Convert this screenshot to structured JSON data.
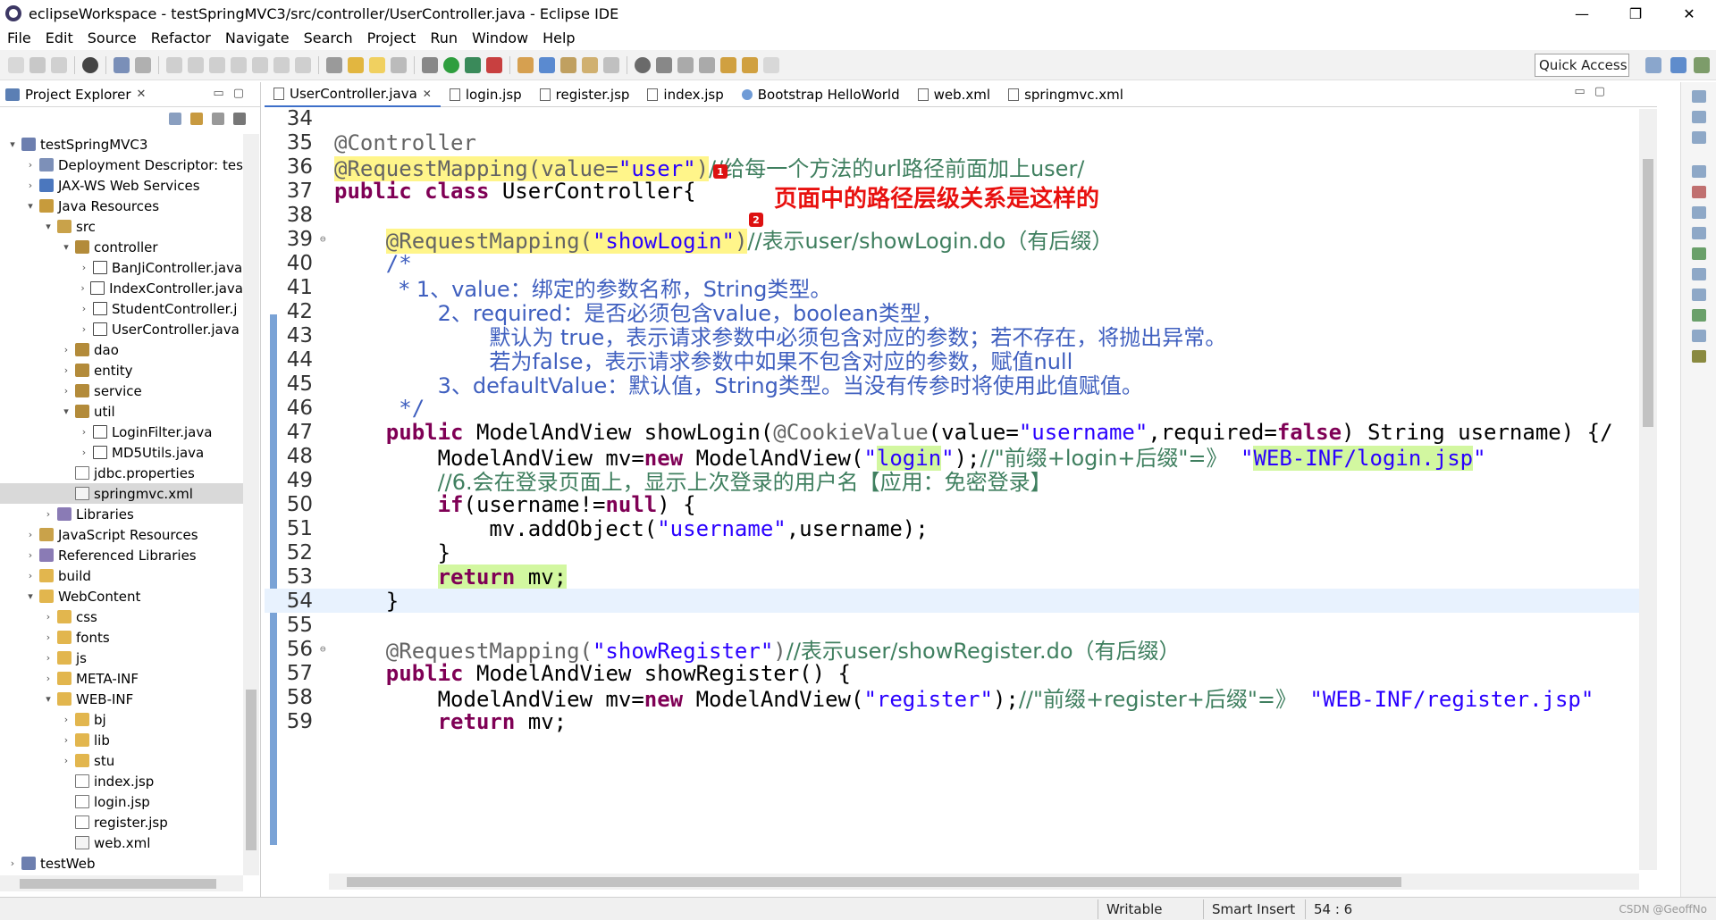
{
  "window": {
    "title": "eclipseWorkspace - testSpringMVC3/src/controller/UserController.java - Eclipse IDE",
    "controls": [
      "—",
      "❐",
      "✕"
    ]
  },
  "menu": [
    "File",
    "Edit",
    "Source",
    "Refactor",
    "Navigate",
    "Search",
    "Project",
    "Run",
    "Window",
    "Help"
  ],
  "toolbar": {
    "quick_access": "Quick Access"
  },
  "project_explorer": {
    "title": "Project Explorer",
    "close": "✕",
    "tree": [
      {
        "label": "testSpringMVC3",
        "twisty": "▾",
        "icon": "ic-project",
        "icon_name": "project-icon"
      },
      {
        "label": "Deployment Descriptor: tes",
        "twisty": "›",
        "icon": "ic-descriptor",
        "icon_name": "deployment-descriptor-icon"
      },
      {
        "label": "JAX-WS Web Services",
        "twisty": "›",
        "icon": "ic-ws",
        "icon_name": "web-services-icon"
      },
      {
        "label": "Java Resources",
        "twisty": "▾",
        "icon": "ic-javares",
        "icon_name": "java-resources-icon"
      },
      {
        "label": "src",
        "twisty": "▾",
        "icon": "ic-srcfolder",
        "icon_name": "source-folder-icon"
      },
      {
        "label": "controller",
        "twisty": "▾",
        "icon": "ic-package",
        "icon_name": "package-icon"
      },
      {
        "label": "BanJiController.java",
        "twisty": "›",
        "icon": "ic-java",
        "icon_name": "java-file-icon"
      },
      {
        "label": "IndexController.java",
        "twisty": "›",
        "icon": "ic-java",
        "icon_name": "java-file-icon"
      },
      {
        "label": "StudentController.j",
        "twisty": "›",
        "icon": "ic-java",
        "icon_name": "java-file-icon"
      },
      {
        "label": "UserController.java",
        "twisty": "›",
        "icon": "ic-java",
        "icon_name": "java-file-icon"
      },
      {
        "label": "dao",
        "twisty": "›",
        "icon": "ic-package",
        "icon_name": "package-icon"
      },
      {
        "label": "entity",
        "twisty": "›",
        "icon": "ic-package",
        "icon_name": "package-icon"
      },
      {
        "label": "service",
        "twisty": "›",
        "icon": "ic-package",
        "icon_name": "package-icon"
      },
      {
        "label": "util",
        "twisty": "▾",
        "icon": "ic-package",
        "icon_name": "package-icon"
      },
      {
        "label": "LoginFilter.java",
        "twisty": "›",
        "icon": "ic-java",
        "icon_name": "java-file-icon"
      },
      {
        "label": "MD5Utils.java",
        "twisty": "›",
        "icon": "ic-java",
        "icon_name": "java-file-icon"
      },
      {
        "label": "jdbc.properties",
        "twisty": "",
        "icon": "ic-file",
        "icon_name": "properties-file-icon"
      },
      {
        "label": "springmvc.xml",
        "twisty": "",
        "icon": "ic-xml",
        "icon_name": "xml-file-icon",
        "selected": true
      },
      {
        "label": "Libraries",
        "twisty": "›",
        "icon": "ic-lib",
        "icon_name": "libraries-icon"
      },
      {
        "label": "JavaScript Resources",
        "twisty": "›",
        "icon": "ic-js",
        "icon_name": "javascript-resources-icon"
      },
      {
        "label": "Referenced Libraries",
        "twisty": "›",
        "icon": "ic-lib",
        "icon_name": "referenced-libraries-icon"
      },
      {
        "label": "build",
        "twisty": "›",
        "icon": "ic-folder",
        "icon_name": "folder-icon"
      },
      {
        "label": "WebContent",
        "twisty": "▾",
        "icon": "ic-folder",
        "icon_name": "folder-icon"
      },
      {
        "label": "css",
        "twisty": "›",
        "icon": "ic-folder",
        "icon_name": "folder-icon"
      },
      {
        "label": "fonts",
        "twisty": "›",
        "icon": "ic-folder",
        "icon_name": "folder-icon"
      },
      {
        "label": "js",
        "twisty": "›",
        "icon": "ic-folder",
        "icon_name": "folder-icon"
      },
      {
        "label": "META-INF",
        "twisty": "›",
        "icon": "ic-folder",
        "icon_name": "folder-icon"
      },
      {
        "label": "WEB-INF",
        "twisty": "▾",
        "icon": "ic-folder",
        "icon_name": "folder-icon"
      },
      {
        "label": "bj",
        "twisty": "›",
        "icon": "ic-folder",
        "icon_name": "folder-icon"
      },
      {
        "label": "lib",
        "twisty": "›",
        "icon": "ic-folder",
        "icon_name": "folder-icon"
      },
      {
        "label": "stu",
        "twisty": "›",
        "icon": "ic-folder",
        "icon_name": "folder-icon"
      },
      {
        "label": "index.jsp",
        "twisty": "",
        "icon": "ic-file",
        "icon_name": "jsp-file-icon"
      },
      {
        "label": "login.jsp",
        "twisty": "",
        "icon": "ic-file",
        "icon_name": "jsp-file-icon"
      },
      {
        "label": "register.jsp",
        "twisty": "",
        "icon": "ic-file",
        "icon_name": "jsp-file-icon"
      },
      {
        "label": "web.xml",
        "twisty": "",
        "icon": "ic-xml",
        "icon_name": "xml-file-icon"
      },
      {
        "label": "testWeb",
        "twisty": "›",
        "icon": "ic-project",
        "icon_name": "project-icon"
      }
    ]
  },
  "editor": {
    "tabs": [
      {
        "label": "UserController.java",
        "kind": "java",
        "active": true,
        "close": "✕"
      },
      {
        "label": "login.jsp",
        "kind": "file"
      },
      {
        "label": "register.jsp",
        "kind": "file"
      },
      {
        "label": "index.jsp",
        "kind": "file"
      },
      {
        "label": "Bootstrap HelloWorld",
        "kind": "globe"
      },
      {
        "label": "web.xml",
        "kind": "file"
      },
      {
        "label": "springmvc.xml",
        "kind": "file"
      }
    ],
    "markers": [
      "1",
      "2"
    ],
    "annotation_note": "页面中的路径层级关系是这样的",
    "lines": [
      {
        "n": "34",
        "segs": []
      },
      {
        "n": "35",
        "segs": [
          [
            "ann",
            "@Controller"
          ]
        ]
      },
      {
        "n": "36",
        "segs": [
          [
            "ann hl-yellow",
            "@RequestMapping(value="
          ],
          [
            "str hl-yellow",
            "\"user\""
          ],
          [
            "ann hl-yellow",
            ")"
          ],
          [
            "lcmt cjk",
            "//给每一个方法的url路径前面加上user/"
          ]
        ]
      },
      {
        "n": "37",
        "segs": [
          [
            "kw",
            "public"
          ],
          [
            "",
            " "
          ],
          [
            "kw",
            "class"
          ],
          [
            "",
            " UserController{"
          ]
        ]
      },
      {
        "n": "38",
        "segs": []
      },
      {
        "n": "39",
        "fold": "⊖",
        "segs": [
          [
            "",
            "    "
          ],
          [
            "ann hl-yellow",
            "@RequestMapping("
          ],
          [
            "str hl-yellow",
            "\"showLogin\""
          ],
          [
            "ann hl-yellow",
            ")"
          ],
          [
            "lcmt cjk",
            "//表示user/showLogin.do（有后缀）"
          ]
        ]
      },
      {
        "n": "40",
        "segs": [
          [
            "",
            "    "
          ],
          [
            "cmt",
            "/*"
          ]
        ]
      },
      {
        "n": "41",
        "segs": [
          [
            "",
            "     "
          ],
          [
            "cmt cjk",
            "* 1、value：绑定的参数名称，String类型。"
          ]
        ]
      },
      {
        "n": "42",
        "segs": [
          [
            "",
            "        "
          ],
          [
            "cmt cjk",
            "2、required：是否必须包含value，boolean类型，"
          ]
        ]
      },
      {
        "n": "43",
        "segs": [
          [
            "",
            "            "
          ],
          [
            "cmt cjk",
            "默认为 true，表示请求参数中必须包含对应的参数；若不存在，将抛出异常。"
          ]
        ]
      },
      {
        "n": "44",
        "segs": [
          [
            "",
            "            "
          ],
          [
            "cmt cjk",
            "若为false，表示请求参数中如果不包含对应的参数，赋值null"
          ]
        ]
      },
      {
        "n": "45",
        "segs": [
          [
            "",
            "        "
          ],
          [
            "cmt cjk",
            "3、defaultValue：默认值，String类型。当没有传参时将使用此值赋值。"
          ]
        ]
      },
      {
        "n": "46",
        "segs": [
          [
            "",
            "     "
          ],
          [
            "cmt",
            "*/"
          ]
        ]
      },
      {
        "n": "47",
        "segs": [
          [
            "",
            "    "
          ],
          [
            "kw",
            "public"
          ],
          [
            "",
            " ModelAndView showLogin("
          ],
          [
            "ann",
            "@CookieValue"
          ],
          [
            "",
            "(value="
          ],
          [
            "str",
            "\"username\""
          ],
          [
            "",
            ",required="
          ],
          [
            "kw",
            "false"
          ],
          [
            "",
            ") String username) {/"
          ]
        ]
      },
      {
        "n": "48",
        "segs": [
          [
            "",
            "        ModelAndView mv="
          ],
          [
            "kw",
            "new"
          ],
          [
            "",
            " ModelAndView("
          ],
          [
            "str",
            "\""
          ],
          [
            "str hl-green",
            "login"
          ],
          [
            "str",
            "\""
          ],
          [
            "",
            ");"
          ],
          [
            "lcmt cjk",
            "//\"前缀+login+后缀\"=》"
          ],
          [
            "str",
            " \""
          ],
          [
            "str hl-green",
            "WEB-INF/login.jsp"
          ],
          [
            "str",
            "\""
          ]
        ]
      },
      {
        "n": "49",
        "segs": [
          [
            "",
            "        "
          ],
          [
            "lcmt cjk",
            "//6.会在登录页面上，显示上次登录的用户名【应用：免密登录】"
          ]
        ]
      },
      {
        "n": "50",
        "segs": [
          [
            "",
            "        "
          ],
          [
            "kw",
            "if"
          ],
          [
            "",
            "(username!="
          ],
          [
            "kw",
            "null"
          ],
          [
            "",
            ") {"
          ]
        ]
      },
      {
        "n": "51",
        "segs": [
          [
            "",
            "            mv.addObject("
          ],
          [
            "str",
            "\"username\""
          ],
          [
            "",
            ",username);"
          ]
        ]
      },
      {
        "n": "52",
        "segs": [
          [
            "",
            "        }"
          ]
        ]
      },
      {
        "n": "53",
        "segs": [
          [
            "",
            "        "
          ],
          [
            "kw hl-green",
            "return"
          ],
          [
            "hl-green",
            " mv;"
          ]
        ]
      },
      {
        "n": "54",
        "current": true,
        "segs": [
          [
            "",
            "    }"
          ]
        ]
      },
      {
        "n": "55",
        "segs": []
      },
      {
        "n": "56",
        "fold": "⊖",
        "segs": [
          [
            "",
            "    "
          ],
          [
            "ann",
            "@RequestMapping("
          ],
          [
            "str",
            "\"showRegister\""
          ],
          [
            "ann",
            ")"
          ],
          [
            "lcmt cjk",
            "//表示user/showRegister.do（有后缀）"
          ]
        ]
      },
      {
        "n": "57",
        "segs": [
          [
            "",
            "    "
          ],
          [
            "kw",
            "public"
          ],
          [
            "",
            " ModelAndView showRegister() {"
          ]
        ]
      },
      {
        "n": "58",
        "segs": [
          [
            "",
            "        ModelAndView mv="
          ],
          [
            "kw",
            "new"
          ],
          [
            "",
            " ModelAndView("
          ],
          [
            "str",
            "\"register\""
          ],
          [
            "",
            ");"
          ],
          [
            "lcmt cjk",
            "//\"前缀+register+后缀\"=》"
          ],
          [
            "str",
            " \"WEB-INF/register.jsp\""
          ]
        ]
      },
      {
        "n": "59",
        "segs": [
          [
            "",
            "        "
          ],
          [
            "kw",
            "return"
          ],
          [
            "",
            " mv;"
          ]
        ]
      }
    ]
  },
  "statusbar": {
    "writable": "Writable",
    "insert_mode": "Smart Insert",
    "position": "54 : 6",
    "watermark": "CSDN @GeoffNo"
  },
  "colors": {
    "keyword": "#7f0055",
    "string": "#2a00ff",
    "annotation": "#646464",
    "comment": "#3f7f5f",
    "javadoc": "#3f5fbf",
    "highlight_yellow": "#fff58a",
    "highlight_green": "#d2f7a0",
    "note_red": "#e8110f"
  }
}
